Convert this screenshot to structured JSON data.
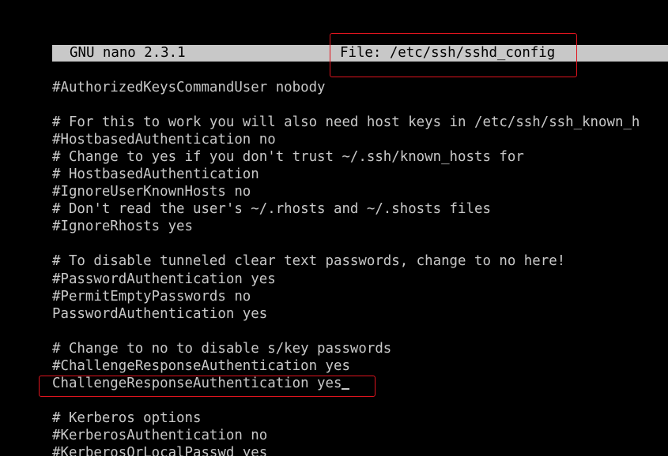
{
  "titlebar": {
    "app_name": "GNU nano 2.3.1",
    "file_label": "File: /etc/ssh/sshd_config"
  },
  "editor": {
    "lines": [
      "#AuthorizedKeysCommandUser nobody",
      "",
      "# For this to work you will also need host keys in /etc/ssh/ssh_known_h",
      "#HostbasedAuthentication no",
      "# Change to yes if you don't trust ~/.ssh/known_hosts for",
      "# HostbasedAuthentication",
      "#IgnoreUserKnownHosts no",
      "# Don't read the user's ~/.rhosts and ~/.shosts files",
      "#IgnoreRhosts yes",
      "",
      "# To disable tunneled clear text passwords, change to no here!",
      "#PasswordAuthentication yes",
      "#PermitEmptyPasswords no",
      "PasswordAuthentication yes",
      "",
      "# Change to no to disable s/key passwords",
      "#ChallengeResponseAuthentication yes",
      "ChallengeResponseAuthentication yes",
      "",
      "# Kerberos options",
      "#KerberosAuthentication no",
      "#KerberosOrLocalPasswd yes"
    ]
  },
  "colors": {
    "background": "#000000",
    "text": "#c8c8c8",
    "titlebar_bg": "#c8c8c8",
    "annotation": "#e0141e"
  }
}
